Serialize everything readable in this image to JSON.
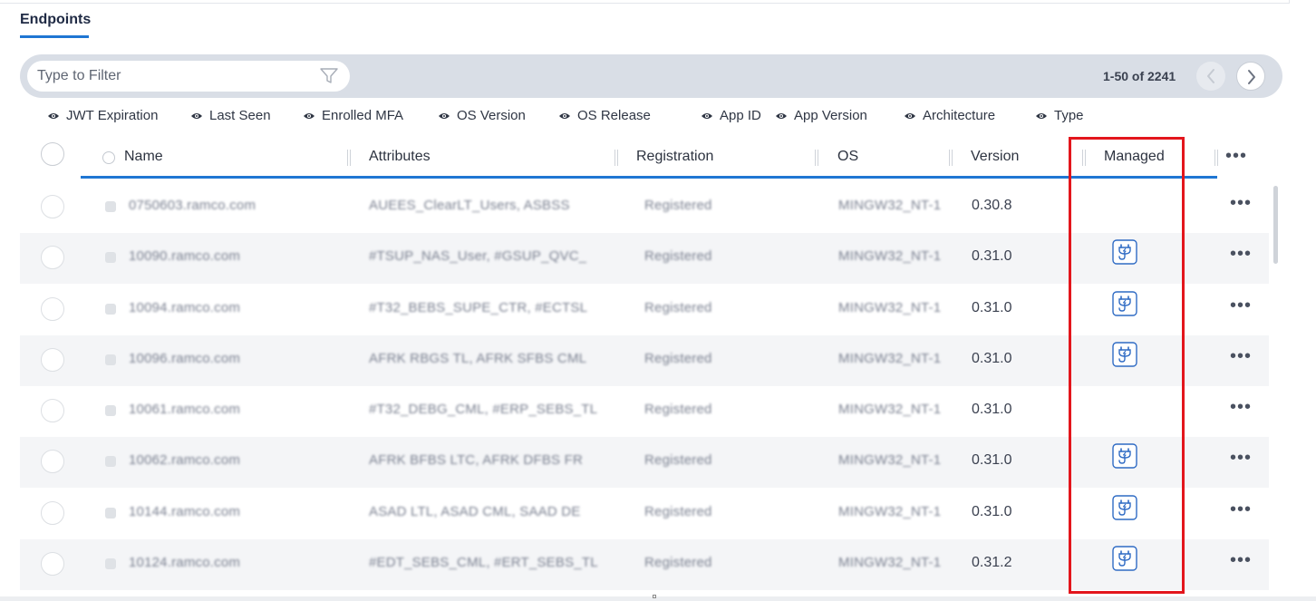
{
  "page": {
    "title": "Endpoints"
  },
  "filter": {
    "placeholder": "Type to Filter"
  },
  "pagination": {
    "range_text": "1-50 of 2241"
  },
  "column_toggles": [
    "JWT Expiration",
    "Last Seen",
    "Enrolled MFA",
    "OS Version",
    "OS Release",
    "App ID",
    "App Version",
    "Architecture",
    "Type"
  ],
  "table": {
    "headers": {
      "name": "Name",
      "attributes": "Attributes",
      "registration": "Registration",
      "os": "OS",
      "version": "Version",
      "managed": "Managed"
    },
    "rows": [
      {
        "name": "0750603.ramco.com",
        "attributes": "AUEES_ClearLT_Users, ASBSS",
        "registration": "Registered",
        "os": "MINGW32_NT-1",
        "version": "0.30.8",
        "managed": false
      },
      {
        "name": "10090.ramco.com",
        "attributes": "#TSUP_NAS_User, #GSUP_QVC_",
        "registration": "Registered",
        "os": "MINGW32_NT-1",
        "version": "0.31.0",
        "managed": true
      },
      {
        "name": "10094.ramco.com",
        "attributes": "#T32_BEBS_SUPE_CTR, #ECTSL",
        "registration": "Registered",
        "os": "MINGW32_NT-1",
        "version": "0.31.0",
        "managed": true
      },
      {
        "name": "10096.ramco.com",
        "attributes": "AFRK RBGS TL, AFRK SFBS CML",
        "registration": "Registered",
        "os": "MINGW32_NT-1",
        "version": "0.31.0",
        "managed": true
      },
      {
        "name": "10061.ramco.com",
        "attributes": "#T32_DEBG_CML, #ERP_SEBS_TL",
        "registration": "Registered",
        "os": "MINGW32_NT-1",
        "version": "0.31.0",
        "managed": false
      },
      {
        "name": "10062.ramco.com",
        "attributes": "AFRK BFBS LTC, AFRK DFBS FR",
        "registration": "Registered",
        "os": "MINGW32_NT-1",
        "version": "0.31.0",
        "managed": true
      },
      {
        "name": "10144.ramco.com",
        "attributes": "ASAD LTL, ASAD CML, SAAD DE",
        "registration": "Registered",
        "os": "MINGW32_NT-1",
        "version": "0.31.0",
        "managed": true
      },
      {
        "name": "10124.ramco.com",
        "attributes": "#EDT_SEBS_CML, #ERT_SEBS_TL",
        "registration": "Registered",
        "os": "MINGW32_NT-1",
        "version": "0.31.2",
        "managed": true
      }
    ]
  },
  "icons": {
    "filter": "funnel-icon",
    "prev": "chevron-left-icon",
    "next": "chevron-right-icon",
    "toggle": "eye-icon",
    "managed": "managed-plug-icon",
    "row_menu": "more-horizontal-icon"
  },
  "colors": {
    "accent": "#1f76d3",
    "highlight": "#e3161c",
    "filter_bar": "#d9dee6"
  }
}
